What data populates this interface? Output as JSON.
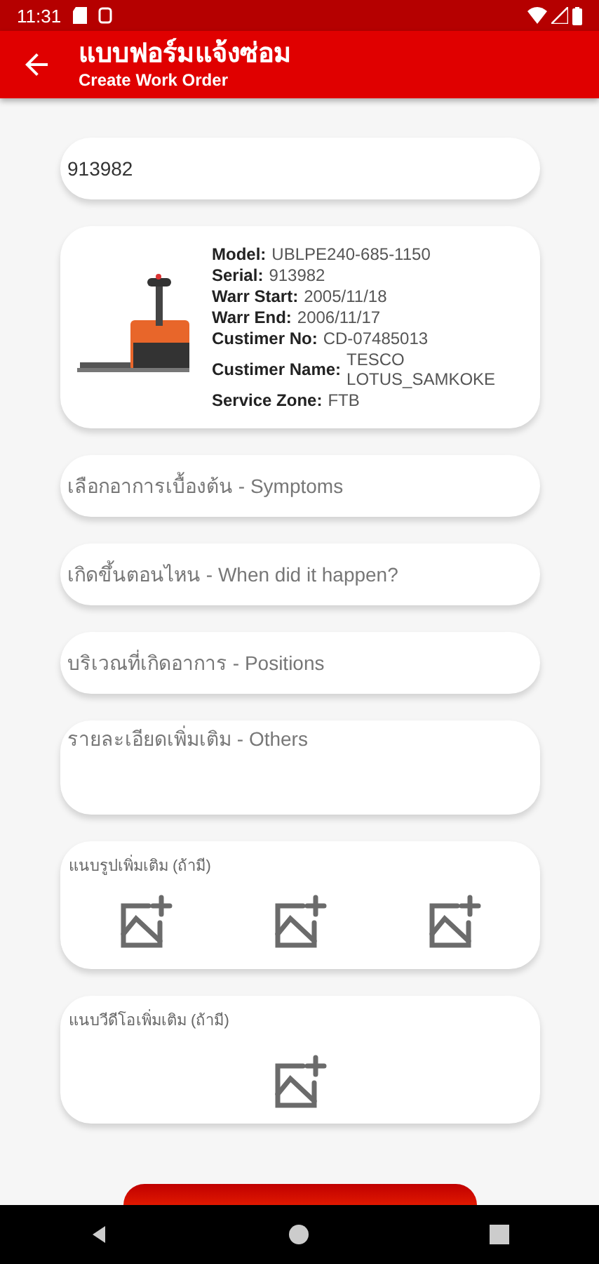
{
  "status_bar": {
    "time": "11:31"
  },
  "app_bar": {
    "title": "แบบฟอร์มแจ้งซ่อม",
    "subtitle": "Create Work Order"
  },
  "serial_field": {
    "value": "913982"
  },
  "machine_card": {
    "rows": [
      {
        "label": "Model:",
        "value": "UBLPE240-685-1150"
      },
      {
        "label": "Serial:",
        "value": "913982"
      },
      {
        "label": "Warr Start:",
        "value": "2005/11/18"
      },
      {
        "label": "Warr End:",
        "value": "2006/11/17"
      },
      {
        "label": "Custimer No:",
        "value": "CD-07485013"
      },
      {
        "label": "Custimer Name:",
        "value": "TESCO LOTUS_SAMKOKE"
      },
      {
        "label": "Service Zone:",
        "value": "FTB"
      }
    ]
  },
  "fields": [
    {
      "kind": "select",
      "placeholder": "เลือกอาการเบื้องต้น - Symptoms"
    },
    {
      "kind": "select",
      "placeholder": "เกิดขึ้นตอนไหน - When did it happen?"
    },
    {
      "kind": "select",
      "placeholder": "บริเวณที่เกิดอาการ - Positions"
    },
    {
      "kind": "textarea",
      "placeholder": "รายละเอียดเพิ่มเติม - Others"
    }
  ],
  "attachments": [
    {
      "title": "แนบรูปเพิ่มเติม (ถ้ามี)",
      "slots": [
        {
          "kind": "add_image"
        },
        {
          "kind": "add_image"
        },
        {
          "kind": "add_image"
        }
      ]
    },
    {
      "title": "แนบวีดีโอเพิ่มเติม (ถ้ามี)",
      "slots": [
        {
          "kind": "add_image"
        }
      ]
    }
  ]
}
